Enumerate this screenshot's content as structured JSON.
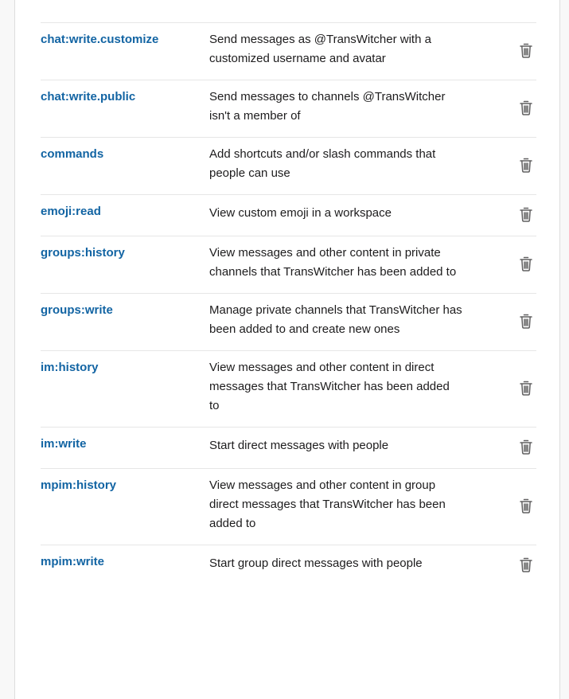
{
  "scopes": [
    {
      "name": "chat:write.customize",
      "description": "Send messages as @TransWitcher with a customized username and avatar",
      "icon": "trash-icon"
    },
    {
      "name": "chat:write.public",
      "description": "Send messages to channels @TransWitcher isn't a member of",
      "icon": "trash-icon"
    },
    {
      "name": "commands",
      "description": "Add shortcuts and/or slash commands that people can use",
      "icon": "trash-icon"
    },
    {
      "name": "emoji:read",
      "description": "View custom emoji in a workspace",
      "icon": "trash-icon"
    },
    {
      "name": "groups:history",
      "description": "View messages and other content in private channels that TransWitcher has been added to",
      "icon": "trash-icon"
    },
    {
      "name": "groups:write",
      "description": "Manage private channels that TransWitcher has been added to and create new ones",
      "icon": "trash-icon"
    },
    {
      "name": "im:history",
      "description": "View messages and other content in direct messages that TransWitcher has been added to",
      "icon": "trash-icon"
    },
    {
      "name": "im:write",
      "description": "Start direct messages with people",
      "icon": "trash-icon"
    },
    {
      "name": "mpim:history",
      "description": "View messages and other content in group direct messages that TransWitcher has been added to",
      "icon": "trash-icon"
    },
    {
      "name": "mpim:write",
      "description": "Start group direct messages with people",
      "icon": "trash-icon"
    }
  ],
  "colors": {
    "scope_name": "#1264a3",
    "description": "#1d1c1d",
    "icon": "#616061",
    "divider": "#e6e6e6"
  }
}
